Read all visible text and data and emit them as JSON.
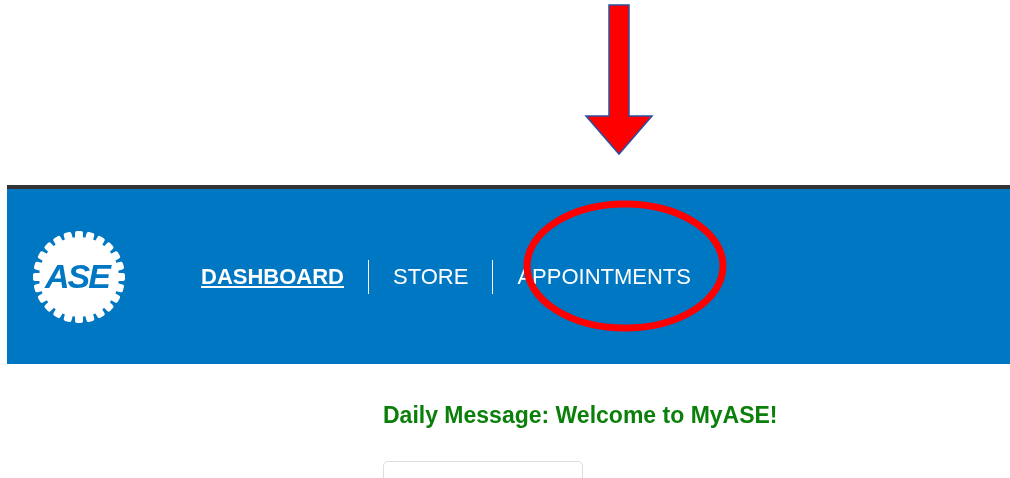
{
  "logo": {
    "text": "ASE"
  },
  "nav": [
    {
      "label": "DASHBOARD",
      "selected": true
    },
    {
      "label": "STORE",
      "selected": false
    },
    {
      "label": "APPOINTMENTS",
      "selected": false
    }
  ],
  "daily_message": "Daily Message: Welcome to MyASE!"
}
